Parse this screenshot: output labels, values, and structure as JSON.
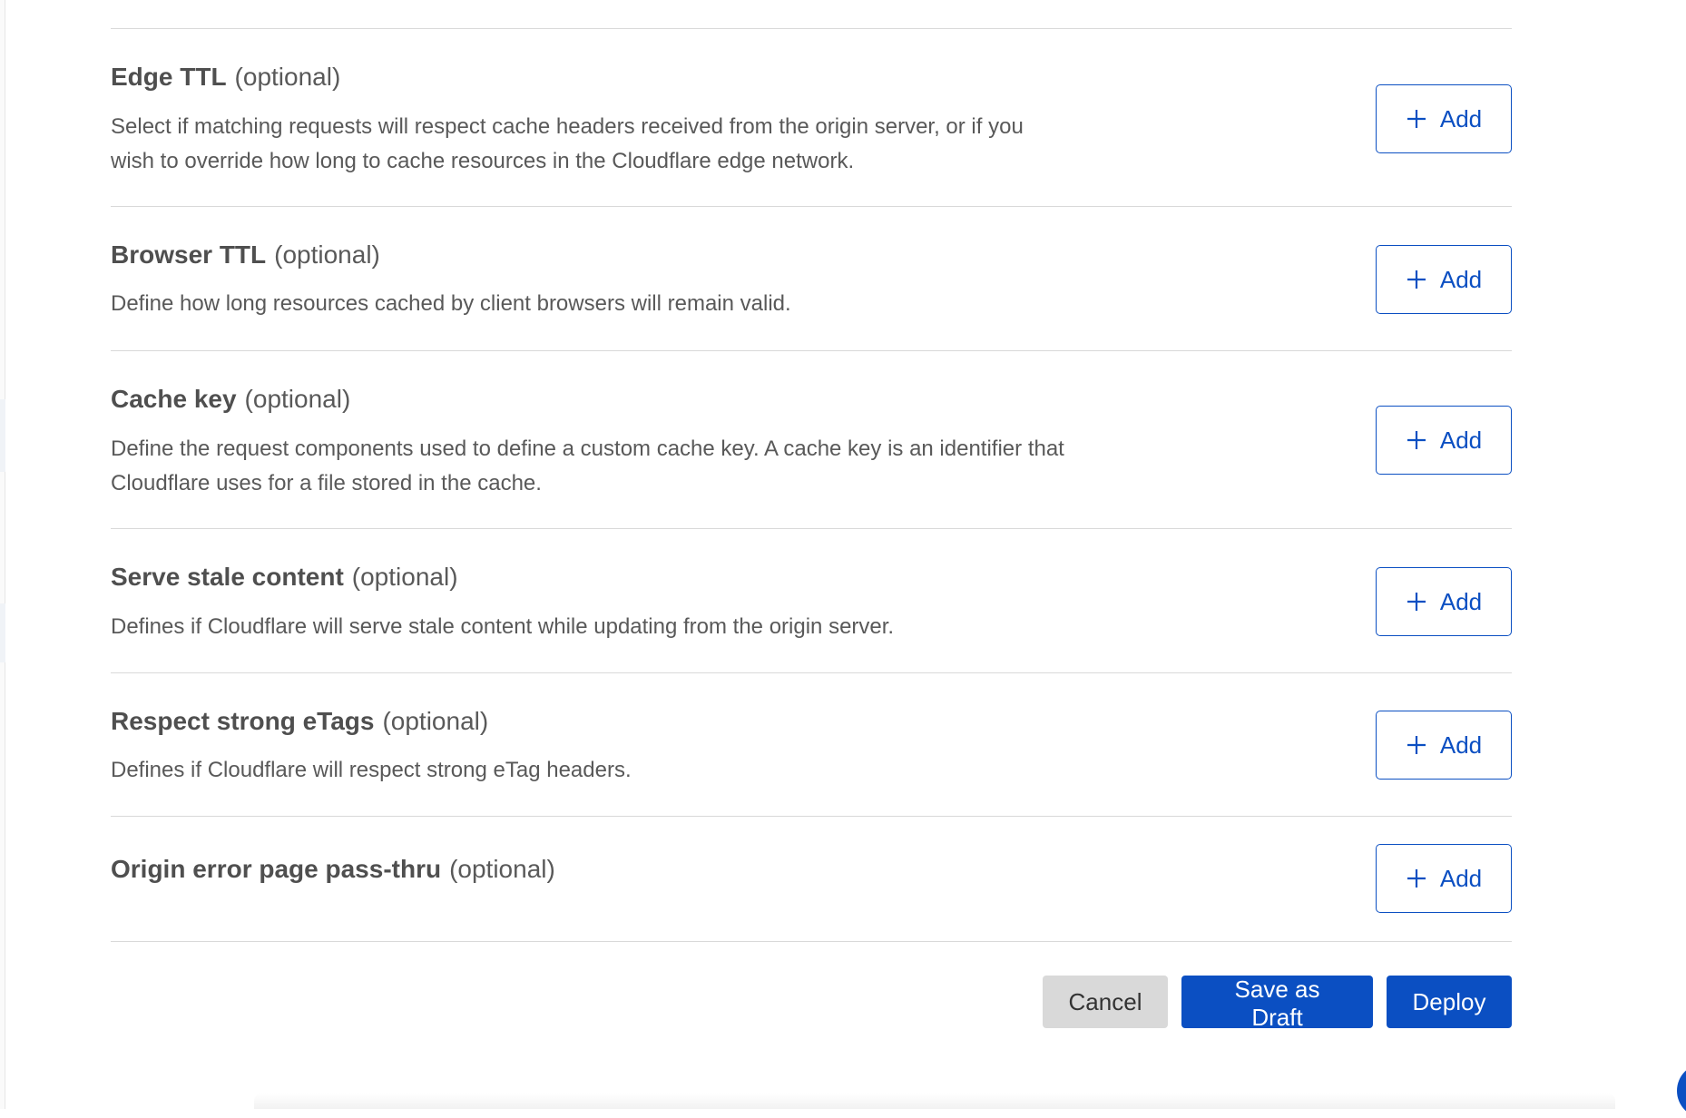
{
  "colors": {
    "accent": "#0b4fc2",
    "cancel_bg": "#d9d9d9",
    "divider": "#d9d9d9",
    "text": "#595959"
  },
  "rows": [
    {
      "title": "Edge TTL",
      "optional": "(optional)",
      "description": "Select if matching requests will respect cache headers received from the origin server, or if you wish to override how long to cache resources in the Cloudflare edge network.",
      "add_label": "Add",
      "add_icon": "plus-icon"
    },
    {
      "title": "Browser TTL",
      "optional": "(optional)",
      "description": "Define how long resources cached by client browsers will remain valid.",
      "add_label": "Add",
      "add_icon": "plus-icon"
    },
    {
      "title": "Cache key",
      "optional": "(optional)",
      "description": "Define the request components used to define a custom cache key. A cache key is an identifier that Cloudflare uses for a file stored in the cache.",
      "add_label": "Add",
      "add_icon": "plus-icon"
    },
    {
      "title": "Serve stale content",
      "optional": "(optional)",
      "description": "Defines if Cloudflare will serve stale content while updating from the origin server.",
      "add_label": "Add",
      "add_icon": "plus-icon"
    },
    {
      "title": "Respect strong eTags",
      "optional": "(optional)",
      "description": "Defines if Cloudflare will respect strong eTag headers.",
      "add_label": "Add",
      "add_icon": "plus-icon"
    },
    {
      "title": "Origin error page pass-thru",
      "optional": "(optional)",
      "description": "",
      "add_label": "Add",
      "add_icon": "plus-icon"
    }
  ],
  "actions": {
    "cancel_label": "Cancel",
    "save_draft_label": "Save as Draft",
    "deploy_label": "Deploy"
  }
}
